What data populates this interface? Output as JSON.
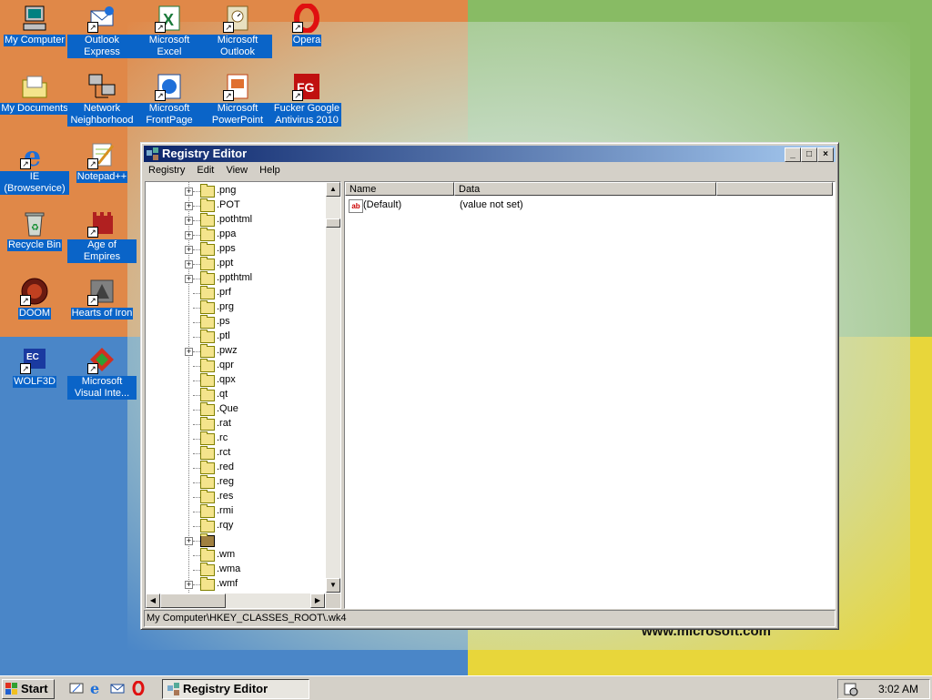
{
  "desktop": {
    "wallpaper_text": "www.microsoft.com",
    "icons": [
      {
        "label": "My Computer"
      },
      {
        "label": "Outlook Express"
      },
      {
        "label": "Microsoft Excel"
      },
      {
        "label": "Microsoft Outlook"
      },
      {
        "label": "Opera"
      },
      {
        "label": "My Documents"
      },
      {
        "label": "Network Neighborhood"
      },
      {
        "label": "Microsoft FrontPage"
      },
      {
        "label": "Microsoft PowerPoint"
      },
      {
        "label": "Fucker Google Antivirus 2010"
      },
      {
        "label": "IE (Browservice)"
      },
      {
        "label": "Notepad++"
      },
      {
        "label": "Recycle Bin"
      },
      {
        "label": "Age of Empires"
      },
      {
        "label": "DOOM"
      },
      {
        "label": "Hearts of Iron"
      },
      {
        "label": "WOLF3D"
      },
      {
        "label": "Microsoft Visual Inte..."
      }
    ]
  },
  "window": {
    "title": "Registry Editor",
    "menu": [
      "Registry",
      "Edit",
      "View",
      "Help"
    ],
    "tree": [
      {
        "label": ".png",
        "expandable": true
      },
      {
        "label": ".POT",
        "expandable": true
      },
      {
        "label": ".pothtml",
        "expandable": true
      },
      {
        "label": ".ppa",
        "expandable": true
      },
      {
        "label": ".pps",
        "expandable": true
      },
      {
        "label": ".ppt",
        "expandable": true
      },
      {
        "label": ".ppthtml",
        "expandable": true
      },
      {
        "label": ".prf",
        "expandable": false
      },
      {
        "label": ".prg",
        "expandable": false
      },
      {
        "label": ".ps",
        "expandable": false
      },
      {
        "label": ".ptl",
        "expandable": false
      },
      {
        "label": ".pwz",
        "expandable": true
      },
      {
        "label": ".qpr",
        "expandable": false
      },
      {
        "label": ".qpx",
        "expandable": false
      },
      {
        "label": ".qt",
        "expandable": false
      },
      {
        "label": ".Que",
        "expandable": false
      },
      {
        "label": ".rat",
        "expandable": false
      },
      {
        "label": ".rc",
        "expandable": false
      },
      {
        "label": ".rct",
        "expandable": false
      },
      {
        "label": ".red",
        "expandable": false
      },
      {
        "label": ".reg",
        "expandable": false
      },
      {
        "label": ".res",
        "expandable": false
      },
      {
        "label": ".rmi",
        "expandable": false
      },
      {
        "label": ".rqy",
        "expandable": false
      },
      {
        "label": "",
        "expandable": true,
        "selected": true
      },
      {
        "label": ".wm",
        "expandable": false
      },
      {
        "label": ".wma",
        "expandable": false
      },
      {
        "label": ".wmf",
        "expandable": true
      }
    ],
    "list_columns": [
      "Name",
      "Data"
    ],
    "values": [
      {
        "name": "(Default)",
        "data": "(value not set)"
      }
    ],
    "status": "My Computer\\HKEY_CLASSES_ROOT\\.wk4"
  },
  "taskbar": {
    "start_label": "Start",
    "task_label": "Registry Editor",
    "clock": "3:02 AM"
  }
}
